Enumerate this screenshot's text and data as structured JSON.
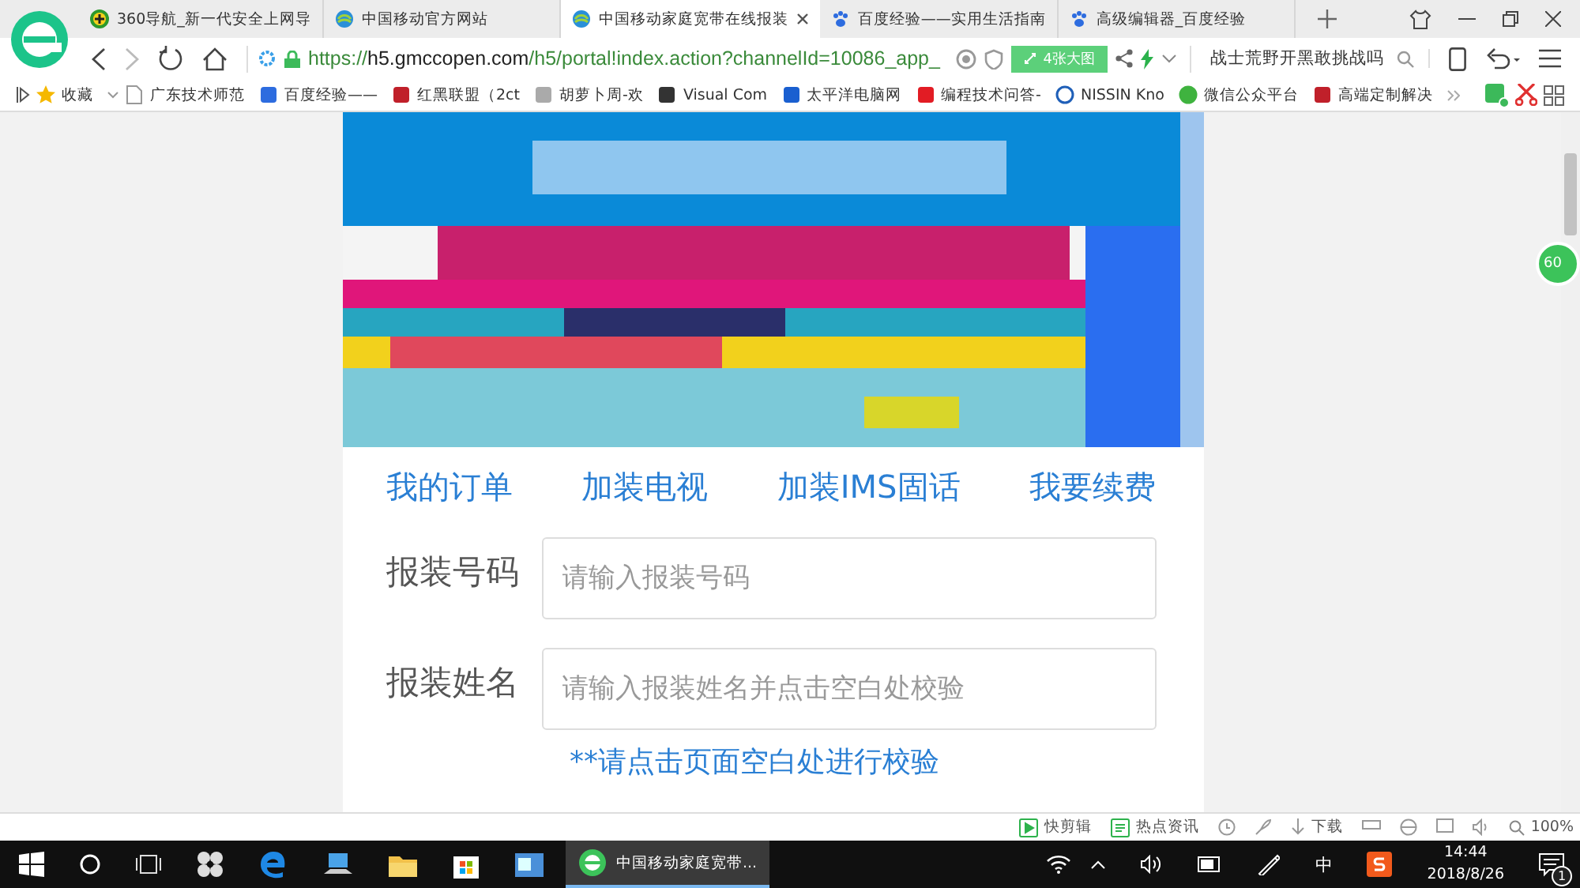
{
  "tabs": [
    {
      "title": "360导航_新一代安全上网导",
      "selected": false
    },
    {
      "title": "中国移动官方网站",
      "selected": false
    },
    {
      "title": "中国移动家庭宽带在线报装",
      "selected": true
    },
    {
      "title": "百度经验——实用生活指南",
      "selected": false
    },
    {
      "title": "高级编辑器_百度经验",
      "selected": false
    }
  ],
  "address_bar": {
    "url": "https://**h5.gmccopen.com**/h5/portal!index.action?channelId=10086_app_",
    "image_badge": "4张大图",
    "search_value": "战士荒野开黑敢挑战吗"
  },
  "bookmarks": [
    "收藏",
    "广东技术师范",
    "百度经验——",
    "红黑联盟（2ct",
    "胡萝卜周-欢",
    "Visual Com",
    "太平洋电脑网",
    "编程技术问答-",
    "NISSIN Kno",
    "微信公众平台",
    "高端定制解决"
  ],
  "page": {
    "banner": {
      "kind": "picture"
    },
    "nav_links": [
      "我的订单",
      "加装电视",
      "加装IMS固话",
      "我要续费"
    ],
    "form_fields": [
      {
        "label": "报装号码",
        "placeholder": "请输入报装号码"
      },
      {
        "label": "报装姓名",
        "placeholder": "请输入报装姓名并点击空白处校验"
      }
    ],
    "hint": "**请点击页面空白处进行校验",
    "side_badge": "60"
  },
  "status_bar": {
    "items": [
      "快剪辑",
      "热点资讯"
    ],
    "download": "下载",
    "zoom": "100%"
  },
  "taskbar": {
    "app_title": "中国移动家庭宽带...",
    "ime": "中",
    "time": "14:44",
    "date": "2018/8/26",
    "notifications": "1"
  }
}
